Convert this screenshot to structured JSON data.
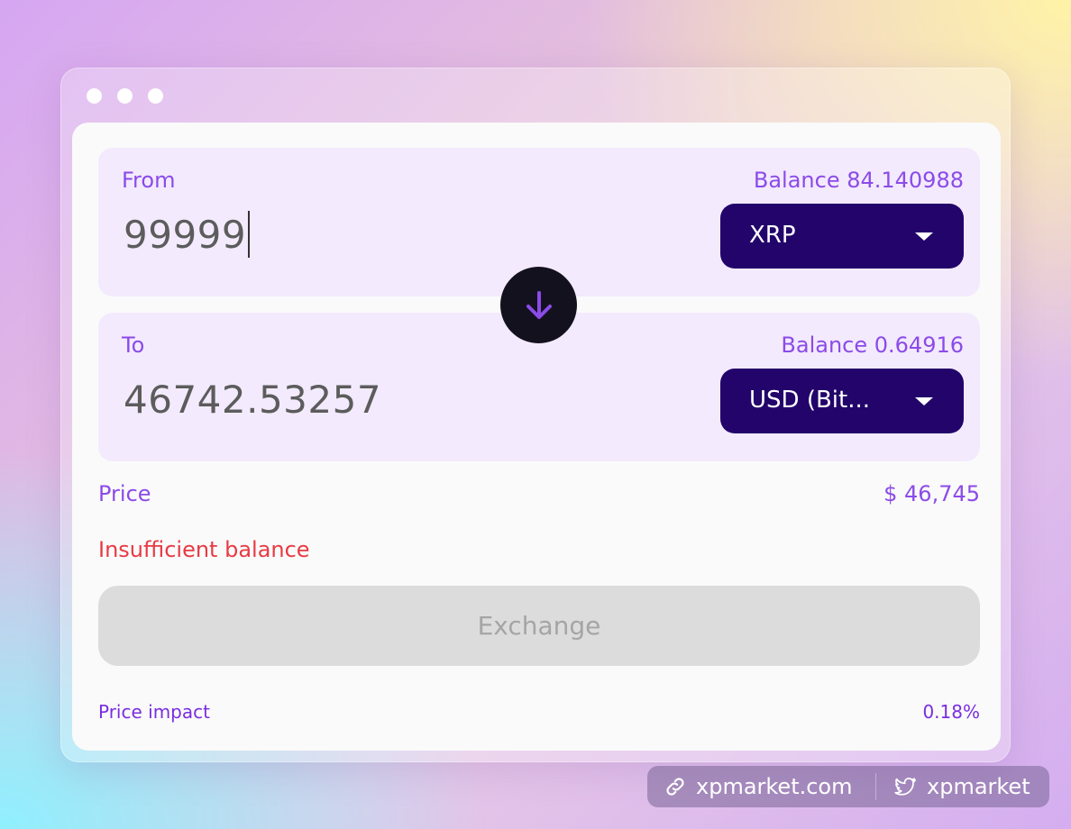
{
  "from": {
    "label": "From",
    "balance": "Balance 84.140988",
    "amount": "99999",
    "token": "XRP"
  },
  "to": {
    "label": "To",
    "balance": "Balance 0.64916",
    "amount": "46742.53257",
    "token": "USD (Bit..."
  },
  "swap": {
    "icon": "arrow-down-icon"
  },
  "price": {
    "label": "Price",
    "value": "$ 46,745"
  },
  "error": "Insufficient balance",
  "exchange_button": "Exchange",
  "price_impact": {
    "label": "Price impact",
    "value": "0.18%"
  },
  "footer": {
    "site": "xpmarket.com",
    "twitter": "xpmarket"
  },
  "colors": {
    "accent": "#8b4be8",
    "token_select_bg": "#22046a",
    "swap_button_bg": "#14111f",
    "error": "#e83a44",
    "panel_bg": "#f3eafd"
  }
}
